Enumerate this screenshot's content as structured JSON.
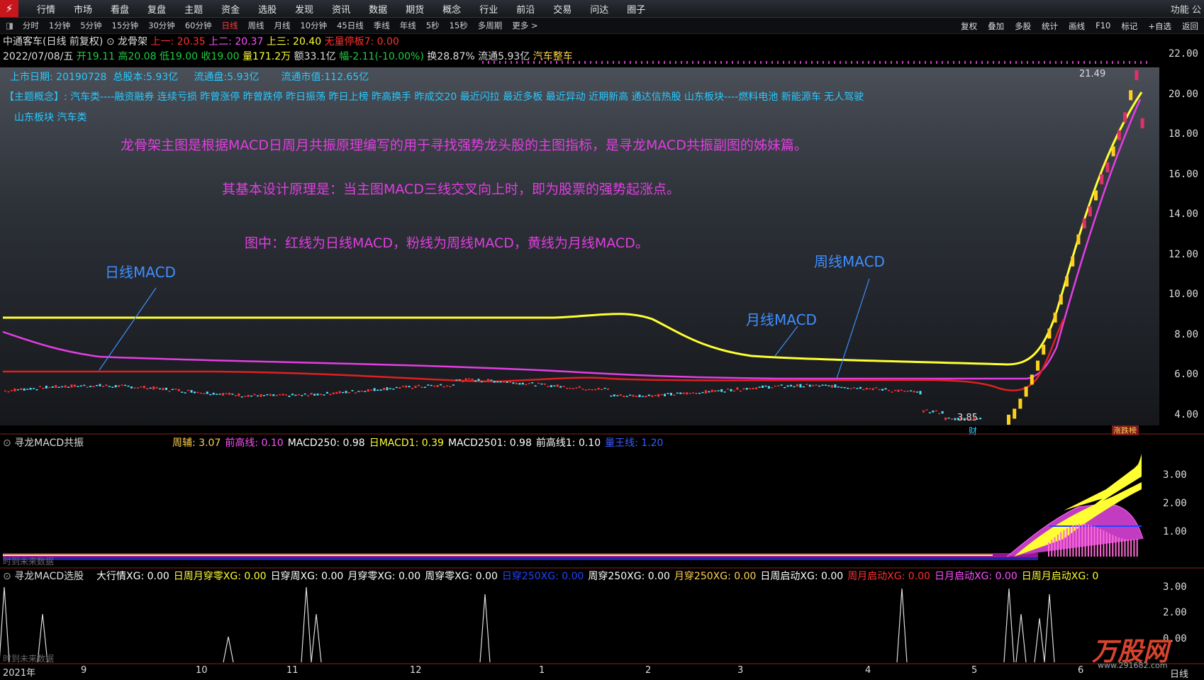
{
  "menubar": {
    "logo": "⚡",
    "items": [
      "行情",
      "市场",
      "看盘",
      "复盘",
      "主题",
      "资金",
      "选股",
      "发现",
      "资讯",
      "数据",
      "期货",
      "概念",
      "行业",
      "前沿",
      "交易",
      "问达",
      "圈子"
    ],
    "right": "功能  公"
  },
  "periods": {
    "items": [
      "分时",
      "1分钟",
      "5分钟",
      "15分钟",
      "30分钟",
      "60分钟",
      "日线",
      "周线",
      "月线",
      "10分钟",
      "45日线",
      "季线",
      "年线",
      "5秒",
      "15秒",
      "多周期",
      "更多 >"
    ],
    "active_index": 6,
    "tools": [
      "复权",
      "叠加",
      "多股",
      "统计",
      "画线",
      "F10",
      "标记",
      "+自选",
      "返回"
    ]
  },
  "stock": {
    "name": "中通客车(日线 前复权)",
    "indicator": "龙骨架",
    "up1": "上一: 20.35",
    "up2": "上二: 20.37",
    "up3": "上三: 20.40",
    "limit": "无量停板7: 0.00"
  },
  "quote": {
    "date": "2022/07/08/五",
    "open": "开19.11",
    "high": "高20.08",
    "low": "低19.00",
    "close": "收19.00",
    "volume": "量171.2万",
    "amount": "额33.1亿",
    "change": "幅-2.11(-10.00%)",
    "turnover": "换28.87%",
    "float": "流通5.93亿",
    "industry": "汽车整车"
  },
  "info": {
    "listing": "上市日期: 20190728",
    "total_shares": "总股本:5.93亿",
    "float_shares": "流通盘:5.93亿",
    "float_value": "流通市值:112.65亿",
    "concepts_label": "【主题概念】:",
    "concepts": "汽车类----融资融券 连续亏损 昨曾涨停 昨曾跌停 昨日振荡 昨日上榜 昨高换手 昨成交20 最近闪拉 最近多板 最近异动 近期新高 通达信热股 山东板块----燃料电池 新能源车 无人驾驶",
    "concepts2": "山东板块 汽车类"
  },
  "annotations": {
    "line1": "龙骨架主图是根据MACD日周月共振原理编写的用于寻找强势龙头股的主图指标，是寻龙MACD共振副图的姊妹篇。",
    "line2": "其基本设计原理是：当主图MACD三线交叉向上时，即为股票的强势起涨点。",
    "line3": "图中：红线为日线MACD，粉线为周线MACD，黄线为月线MACD。",
    "daily": "日线MACD",
    "weekly": "周线MACD",
    "monthly": "月线MACD",
    "high_label": "21.49",
    "low_label": "3.85",
    "fin_tag": "财",
    "badge": "涨跌榜"
  },
  "yaxis_main": [
    "22.00",
    "20.00",
    "18.00",
    "16.00",
    "14.00",
    "12.00",
    "10.00",
    "8.00",
    "6.00",
    "4.00"
  ],
  "sub1": {
    "title": "寻龙MACD共振",
    "values": [
      {
        "t": "周辅: 3.07",
        "c": "#ffd34d"
      },
      {
        "t": "前高线: 0.10",
        "c": "#ff4fff"
      },
      {
        "t": "MACD250: 0.98",
        "c": "#ffffff"
      },
      {
        "t": "日MACD1: 0.39",
        "c": "#ffff33"
      },
      {
        "t": "MACD2501: 0.98",
        "c": "#ffffff"
      },
      {
        "t": "前高线1: 0.10",
        "c": "#ffffff"
      },
      {
        "t": "量王线: 1.20",
        "c": "#3a5bff"
      }
    ],
    "yaxis": [
      "3.00",
      "2.00",
      "1.00"
    ],
    "nodata": "时到未来数据"
  },
  "sub2": {
    "title": "寻龙MACD选股",
    "values": [
      {
        "t": "大行情XG: 0.00",
        "c": "#ffffff"
      },
      {
        "t": "日周月穿零XG: 0.00",
        "c": "#ffff33"
      },
      {
        "t": "日穿周XG: 0.00",
        "c": "#ffffff"
      },
      {
        "t": "月穿零XG: 0.00",
        "c": "#ffffff"
      },
      {
        "t": "周穿零XG: 0.00",
        "c": "#ffffff"
      },
      {
        "t": "日穿250XG: 0.00",
        "c": "#2244ff"
      },
      {
        "t": "周穿250XG: 0.00",
        "c": "#ffffff"
      },
      {
        "t": "月穿250XG: 0.00",
        "c": "#ffd34d"
      },
      {
        "t": "日周启动XG: 0.00",
        "c": "#ffffff"
      },
      {
        "t": "周月启动XG: 0.00",
        "c": "#ff3030"
      },
      {
        "t": "日月启动XG: 0.00",
        "c": "#ff4fff"
      },
      {
        "t": "日周月启动XG: 0",
        "c": "#ffff33"
      }
    ],
    "yaxis": [
      "3.00",
      "2.00",
      "0.00"
    ],
    "nodata": "时到未来数据"
  },
  "xaxis": [
    "2021年",
    "9",
    "10",
    "11",
    "12",
    "1",
    "2",
    "3",
    "4",
    "5",
    "6"
  ],
  "xaxis_right": "日线",
  "watermark": "万股网",
  "watermark_url": "www.291682.com"
}
